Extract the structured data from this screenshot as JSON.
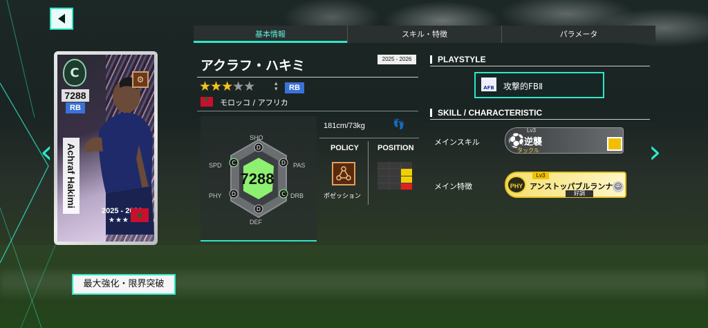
{
  "tabs": [
    {
      "label": "基本情報",
      "active": true
    },
    {
      "label": "スキル・特徴",
      "active": false
    },
    {
      "label": "パラメータ",
      "active": false
    }
  ],
  "player": {
    "name": "アクラフ・ハキミ",
    "season": "2025 - 2026",
    "stars_on": 3,
    "stars_total": 5,
    "position": "RB",
    "nation": "モロッコ / アフリカ",
    "height_weight": "181cm/73kg",
    "ovr": "7288"
  },
  "card": {
    "rank": "C",
    "ovr": "7288",
    "position": "RB",
    "name": "Achraf Hakimi",
    "season": "2025 - 2026",
    "stars": "★★★"
  },
  "stats": {
    "labels": [
      "SHO",
      "PAS",
      "DRB",
      "DEF",
      "PHY",
      "SPD"
    ],
    "grades": [
      "D",
      "D",
      "C",
      "D",
      "D",
      "C"
    ]
  },
  "policy": {
    "policy_label": "POLICY",
    "position_label": "POSITION",
    "policy_caption": "ポゼッション"
  },
  "right": {
    "playstyle_head": "PLAYSTYLE",
    "playstyle_icon_text": "AFB",
    "playstyle_value": "攻撃的FBⅡ",
    "skill_head": "SKILL / CHARACTERISTIC",
    "main_skill_label": "メインスキル",
    "main_skill_lv": "Lv3",
    "main_skill_name": "逆襲",
    "main_skill_sub": "タックル",
    "main_trait_label": "メイン特徴",
    "main_trait_icon": "PHY",
    "main_trait_lv": "Lv3",
    "main_trait_name": "アンストッパブルランナー",
    "main_trait_sub": "好調"
  },
  "buttons": {
    "max_enhance": "最大強化・限界突破"
  },
  "colors": {
    "accent": "#2ee8c8",
    "star_on": "#f5c518",
    "position_blue": "#3a72d8"
  }
}
